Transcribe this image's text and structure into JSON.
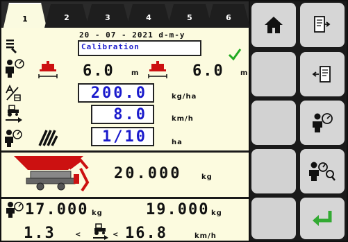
{
  "tabs": [
    "1",
    "2",
    "3",
    "4",
    "5",
    "6"
  ],
  "active_tab": "1",
  "date": "20 - 07 - 2021 d-m-y",
  "mode_label": "Calibration",
  "spread_left": {
    "value": "6.0",
    "unit": "m"
  },
  "spread_right": {
    "value": "6.0",
    "unit": "m"
  },
  "rate": {
    "value": "200.0",
    "unit": "kg/ha"
  },
  "speed": {
    "value": "8.0",
    "unit": "km/h"
  },
  "area": {
    "value": "1/10",
    "unit": "ha"
  },
  "hopper": {
    "value": "20.000",
    "unit": "kg"
  },
  "totals": {
    "left_value": "17.000",
    "left_unit": "kg",
    "right_value": "19.000",
    "right_unit": "kg"
  },
  "speed_range": {
    "min": "1.3",
    "lt1": "<",
    "lt2": "<",
    "max": "16.8",
    "unit": "km/h"
  },
  "colors": {
    "panel": "#fcfbdf",
    "value_blue": "#2222cc",
    "check_green": "#22aa22",
    "hopper_red": "#cc1111",
    "enter_green": "#33aa33"
  },
  "icons": [
    "list-icon",
    "operator-gauge-icon",
    "spreader-red-icon",
    "check-icon",
    "ratio-icon",
    "tractor-speed-icon",
    "hatch-area-icon",
    "hopper-icon",
    "home-icon",
    "doc-export-icon",
    "screen-import-icon",
    "operator-icon",
    "operator-search-icon",
    "enter-icon"
  ]
}
